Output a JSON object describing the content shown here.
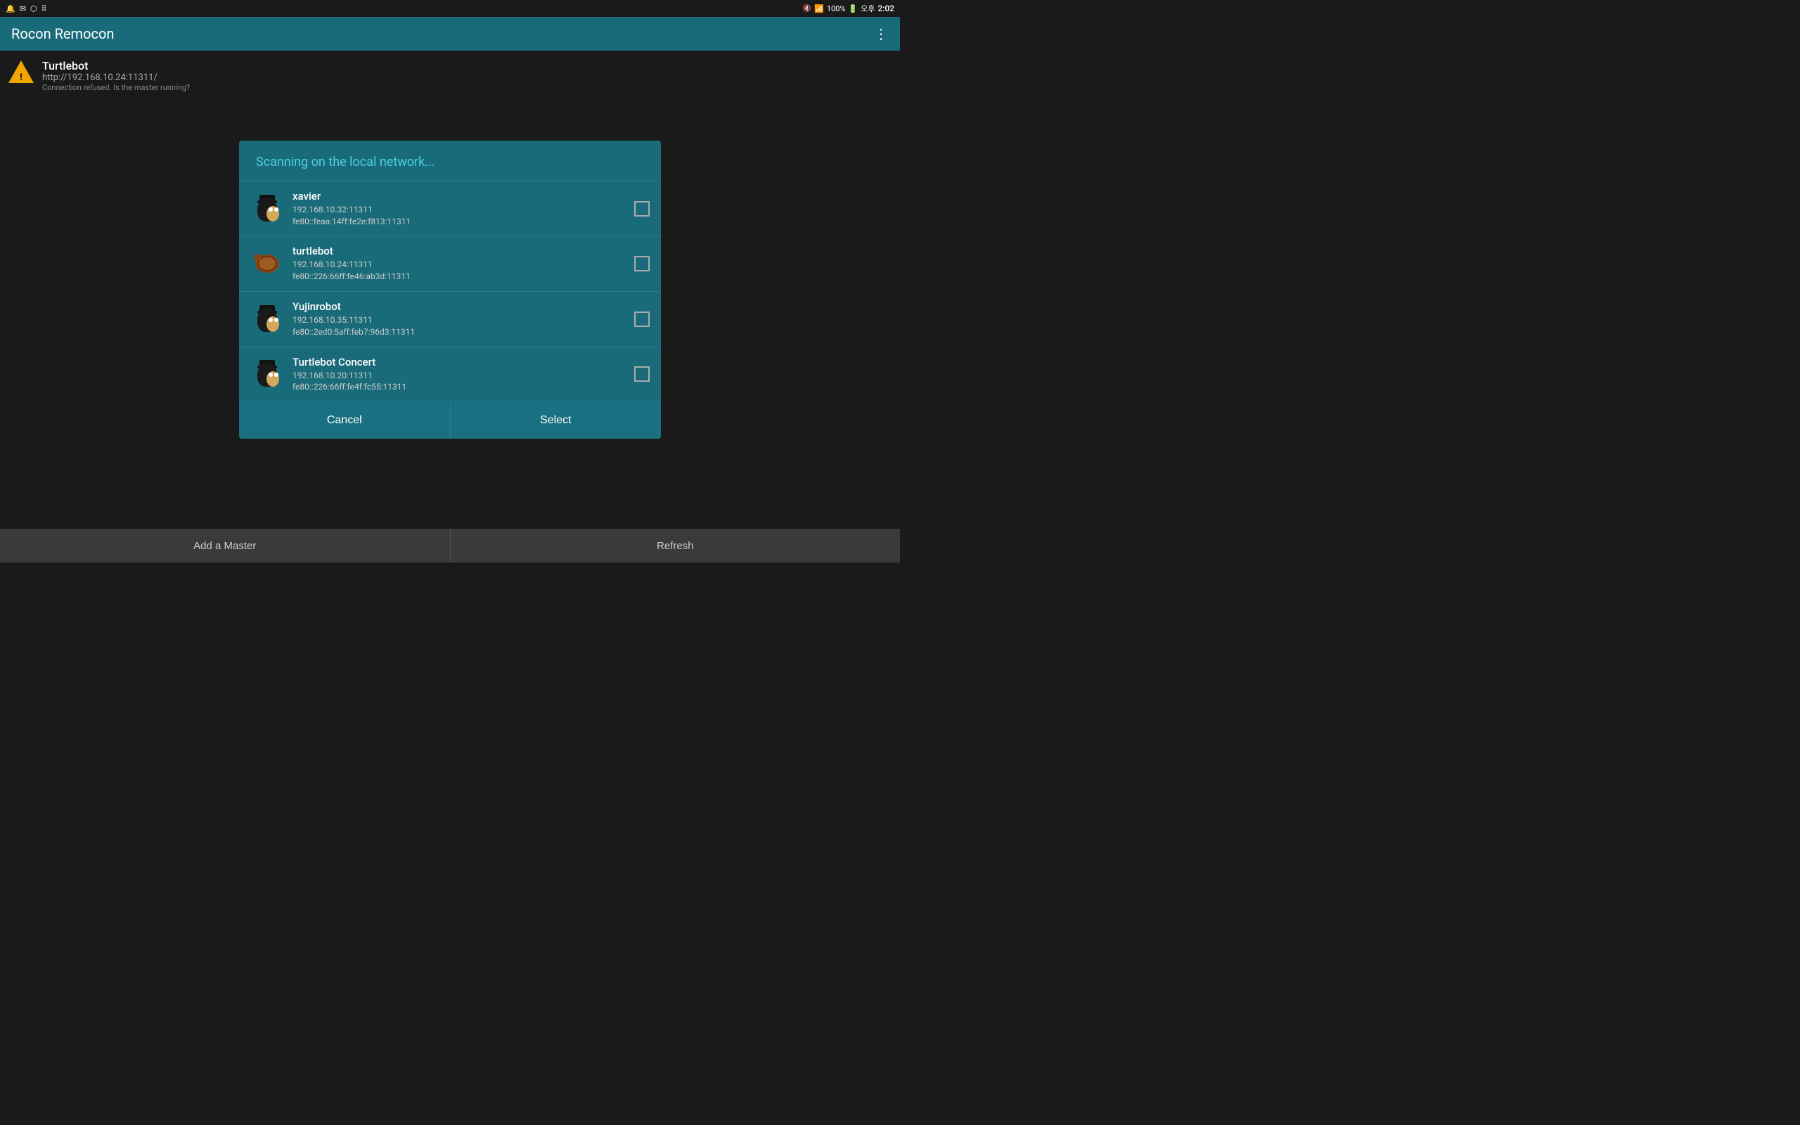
{
  "statusBar": {
    "time": "2:02",
    "battery": "100%",
    "indicator": "오후"
  },
  "appBar": {
    "title": "Rocon Remocon",
    "overflow_menu": "⋮"
  },
  "masterItem": {
    "name": "Turtlebot",
    "url": "http://192.168.10.24:11311/",
    "status": "Connection refused. Is the master running?"
  },
  "dialog": {
    "title": "Scanning on the local network...",
    "robots": [
      {
        "name": "xavier",
        "ip": "192.168.10.32:11311",
        "ipv6": "fe80::feaa:14ff:fe2e:f813:11311",
        "type": "penguin"
      },
      {
        "name": "turtlebot",
        "ip": "192.168.10.24:11311",
        "ipv6": "fe80::226:66ff:fe46:ab3d:11311",
        "type": "turtle"
      },
      {
        "name": "Yujinrobot",
        "ip": "192.168.10.35:11311",
        "ipv6": "fe80::2ed0:5aff:feb7:96d3:11311",
        "type": "penguin"
      },
      {
        "name": "Turtlebot Concert",
        "ip": "192.168.10.20:11311",
        "ipv6": "fe80::226:66ff:fe4f:fc55:11311",
        "type": "penguin"
      }
    ],
    "cancelButton": "Cancel",
    "selectButton": "Select"
  },
  "bottomBar": {
    "addMaster": "Add a Master",
    "refresh": "Refresh"
  }
}
